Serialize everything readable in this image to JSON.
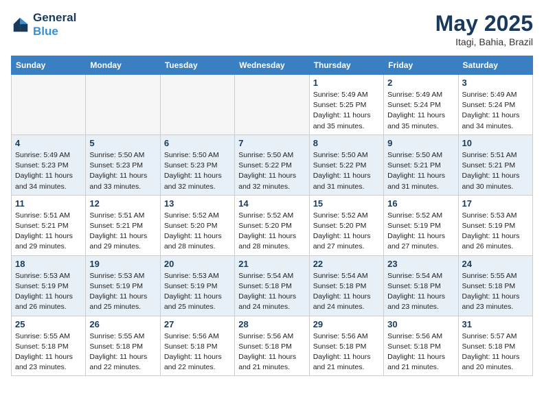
{
  "header": {
    "logo_line1": "General",
    "logo_line2": "Blue",
    "month": "May 2025",
    "location": "Itagi, Bahia, Brazil"
  },
  "days_of_week": [
    "Sunday",
    "Monday",
    "Tuesday",
    "Wednesday",
    "Thursday",
    "Friday",
    "Saturday"
  ],
  "weeks": [
    [
      {
        "num": "",
        "info": ""
      },
      {
        "num": "",
        "info": ""
      },
      {
        "num": "",
        "info": ""
      },
      {
        "num": "",
        "info": ""
      },
      {
        "num": "1",
        "info": "Sunrise: 5:49 AM\nSunset: 5:25 PM\nDaylight: 11 hours\nand 35 minutes."
      },
      {
        "num": "2",
        "info": "Sunrise: 5:49 AM\nSunset: 5:24 PM\nDaylight: 11 hours\nand 35 minutes."
      },
      {
        "num": "3",
        "info": "Sunrise: 5:49 AM\nSunset: 5:24 PM\nDaylight: 11 hours\nand 34 minutes."
      }
    ],
    [
      {
        "num": "4",
        "info": "Sunrise: 5:49 AM\nSunset: 5:23 PM\nDaylight: 11 hours\nand 34 minutes."
      },
      {
        "num": "5",
        "info": "Sunrise: 5:50 AM\nSunset: 5:23 PM\nDaylight: 11 hours\nand 33 minutes."
      },
      {
        "num": "6",
        "info": "Sunrise: 5:50 AM\nSunset: 5:23 PM\nDaylight: 11 hours\nand 32 minutes."
      },
      {
        "num": "7",
        "info": "Sunrise: 5:50 AM\nSunset: 5:22 PM\nDaylight: 11 hours\nand 32 minutes."
      },
      {
        "num": "8",
        "info": "Sunrise: 5:50 AM\nSunset: 5:22 PM\nDaylight: 11 hours\nand 31 minutes."
      },
      {
        "num": "9",
        "info": "Sunrise: 5:50 AM\nSunset: 5:21 PM\nDaylight: 11 hours\nand 31 minutes."
      },
      {
        "num": "10",
        "info": "Sunrise: 5:51 AM\nSunset: 5:21 PM\nDaylight: 11 hours\nand 30 minutes."
      }
    ],
    [
      {
        "num": "11",
        "info": "Sunrise: 5:51 AM\nSunset: 5:21 PM\nDaylight: 11 hours\nand 29 minutes."
      },
      {
        "num": "12",
        "info": "Sunrise: 5:51 AM\nSunset: 5:21 PM\nDaylight: 11 hours\nand 29 minutes."
      },
      {
        "num": "13",
        "info": "Sunrise: 5:52 AM\nSunset: 5:20 PM\nDaylight: 11 hours\nand 28 minutes."
      },
      {
        "num": "14",
        "info": "Sunrise: 5:52 AM\nSunset: 5:20 PM\nDaylight: 11 hours\nand 28 minutes."
      },
      {
        "num": "15",
        "info": "Sunrise: 5:52 AM\nSunset: 5:20 PM\nDaylight: 11 hours\nand 27 minutes."
      },
      {
        "num": "16",
        "info": "Sunrise: 5:52 AM\nSunset: 5:19 PM\nDaylight: 11 hours\nand 27 minutes."
      },
      {
        "num": "17",
        "info": "Sunrise: 5:53 AM\nSunset: 5:19 PM\nDaylight: 11 hours\nand 26 minutes."
      }
    ],
    [
      {
        "num": "18",
        "info": "Sunrise: 5:53 AM\nSunset: 5:19 PM\nDaylight: 11 hours\nand 26 minutes."
      },
      {
        "num": "19",
        "info": "Sunrise: 5:53 AM\nSunset: 5:19 PM\nDaylight: 11 hours\nand 25 minutes."
      },
      {
        "num": "20",
        "info": "Sunrise: 5:53 AM\nSunset: 5:19 PM\nDaylight: 11 hours\nand 25 minutes."
      },
      {
        "num": "21",
        "info": "Sunrise: 5:54 AM\nSunset: 5:18 PM\nDaylight: 11 hours\nand 24 minutes."
      },
      {
        "num": "22",
        "info": "Sunrise: 5:54 AM\nSunset: 5:18 PM\nDaylight: 11 hours\nand 24 minutes."
      },
      {
        "num": "23",
        "info": "Sunrise: 5:54 AM\nSunset: 5:18 PM\nDaylight: 11 hours\nand 23 minutes."
      },
      {
        "num": "24",
        "info": "Sunrise: 5:55 AM\nSunset: 5:18 PM\nDaylight: 11 hours\nand 23 minutes."
      }
    ],
    [
      {
        "num": "25",
        "info": "Sunrise: 5:55 AM\nSunset: 5:18 PM\nDaylight: 11 hours\nand 23 minutes."
      },
      {
        "num": "26",
        "info": "Sunrise: 5:55 AM\nSunset: 5:18 PM\nDaylight: 11 hours\nand 22 minutes."
      },
      {
        "num": "27",
        "info": "Sunrise: 5:56 AM\nSunset: 5:18 PM\nDaylight: 11 hours\nand 22 minutes."
      },
      {
        "num": "28",
        "info": "Sunrise: 5:56 AM\nSunset: 5:18 PM\nDaylight: 11 hours\nand 21 minutes."
      },
      {
        "num": "29",
        "info": "Sunrise: 5:56 AM\nSunset: 5:18 PM\nDaylight: 11 hours\nand 21 minutes."
      },
      {
        "num": "30",
        "info": "Sunrise: 5:56 AM\nSunset: 5:18 PM\nDaylight: 11 hours\nand 21 minutes."
      },
      {
        "num": "31",
        "info": "Sunrise: 5:57 AM\nSunset: 5:18 PM\nDaylight: 11 hours\nand 20 minutes."
      }
    ]
  ]
}
